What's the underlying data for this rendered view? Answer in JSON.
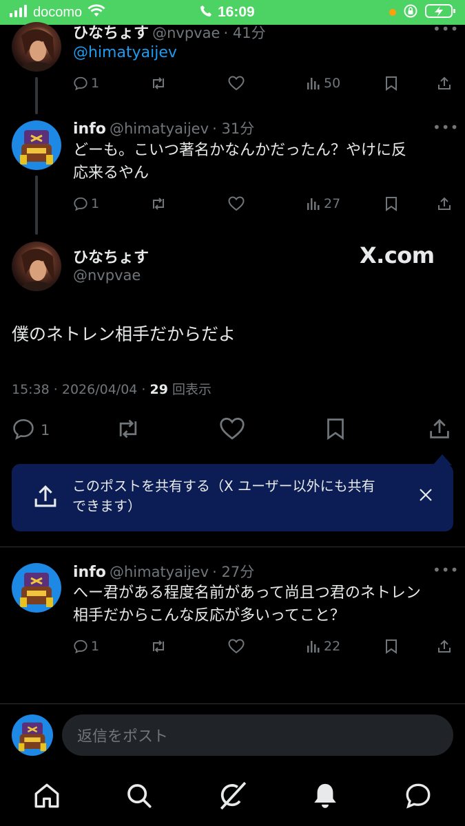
{
  "status_bar": {
    "carrier": "docomo",
    "time": "16:09"
  },
  "tweets": [
    {
      "name": "ひなちょす",
      "handle": "@nvpvae",
      "time": "41分",
      "text": "@himatyaijev",
      "stats": {
        "replies": "1",
        "views": "50"
      }
    },
    {
      "name": "info",
      "handle": "@himatyaijev",
      "time": "31分",
      "text_line1": "どーも。こいつ著名かなんかだったん？やけに反",
      "text_line2": "応来るやん",
      "stats": {
        "replies": "1",
        "views": "27"
      }
    }
  ],
  "main_tweet": {
    "name": "ひなちょす",
    "handle": "@nvpvae",
    "watermark": "X.com",
    "text": "僕のネトレン相手だからだよ",
    "timestamp": "15:38 · 2026/04/04 · ",
    "views_count": "29",
    "views_label": " 回表示",
    "reply_count": "1"
  },
  "share_toast": {
    "line1": "このポストを共有する（X ユーザー以外にも共有",
    "line2": "できます）"
  },
  "reply_tweet": {
    "name": "info",
    "handle": "@himatyaijev",
    "time": "27分",
    "text_line1": "へー君がある程度名前があって尚且つ君のネトレン",
    "text_line2": "相手だからこんな反応が多いってこと？",
    "stats": {
      "replies": "1",
      "views": "22"
    }
  },
  "composer": {
    "placeholder": "返信をポスト"
  },
  "colors": {
    "status_bar": "#4cd364",
    "link": "#1d9bf0",
    "toast_bg": "#0b1d54",
    "secondary_text": "#71767b"
  }
}
